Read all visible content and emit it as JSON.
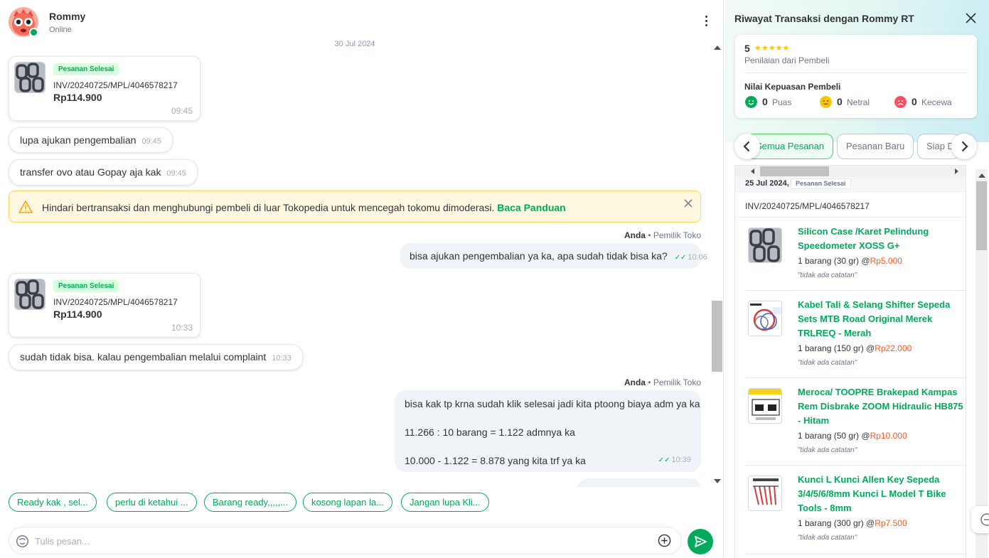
{
  "colors": {
    "accent": "#00aa5b",
    "price": "#fa591d",
    "warning_bg": "#fff8e1",
    "star": "#ffc400"
  },
  "chat": {
    "contact_name": "Rommy",
    "contact_status": "Online",
    "date_separator": "30 Jul 2024",
    "order_cards": [
      {
        "badge": "Pesanan Selesai",
        "invoice": "INV/20240725/MPL/4046578217",
        "price": "Rp114.900",
        "time": "09:45"
      },
      {
        "badge": "Pesanan Selesai",
        "invoice": "INV/20240725/MPL/4046578217",
        "price": "Rp114.900",
        "time": "10:33"
      }
    ],
    "messages": [
      {
        "text": "lupa ajukan pengembalian",
        "time": "09:45"
      },
      {
        "text": "transfer ovo atau Gopay aja kak",
        "time": "09:45"
      },
      {
        "text": "bisa ajukan pengembalian ya ka, apa sudah tidak bisa ka?",
        "time": "10:06"
      },
      {
        "text": "sudah tidak bisa. kalau pengembalian melalui complaint",
        "time": "10:33"
      },
      {
        "line1": "bisa kak tp krna sudah klik selesai jadi kita ptoong biaya adm ya ka",
        "line2": "11.266 : 10 barang = 1.122 admnya ka",
        "line3": "10.000 - 1.122 = 8.878 yang kita trf ya ka",
        "time": "10:39"
      }
    ],
    "sender": {
      "name": "Anda",
      "role": "• Pemilik Toko"
    },
    "warning": {
      "text": "Hindari bertransaksi dan menghubungi pembeli di luar Tokopedia untuk mencegah tokomu dimoderasi.",
      "link": "Baca Panduan"
    },
    "quick_replies": [
      "Ready kak , sel...",
      "perlu di ketahui ...",
      "Barang ready,,,,,...",
      "kosong lapan la...",
      "Jangan lupa Kli..."
    ],
    "input_placeholder": "Tulis pesan..."
  },
  "panel": {
    "title": "Riwayat Transaksi dengan Rommy RT",
    "rating": {
      "value": "5",
      "stars": "★★★★★",
      "label": "Penilaian dari Pembeli"
    },
    "satisfaction": {
      "title": "Nilai Kepuasan Pembeli",
      "items": [
        {
          "count": "0",
          "label": "Puas"
        },
        {
          "count": "0",
          "label": "Netral"
        },
        {
          "count": "0",
          "label": "Kecewa"
        }
      ]
    },
    "filters": [
      "Semua Pesanan",
      "Pesanan Baru",
      "Siap Dikirim"
    ],
    "order": {
      "date": "25 Jul 2024,",
      "badge": "Pesanan Selesai",
      "invoice": "INV/20240725/MPL/4046578217",
      "products": [
        {
          "name": "Silicon Case /Karet Pelindung Speedometer XOSS G+",
          "qty": "1 barang (30 gr) @",
          "price": "Rp5.000",
          "note": "\"tidak ada catatan\""
        },
        {
          "name": "Kabel Tali & Selang Shifter Sepeda Sets MTB Road Original Merek TRLREQ - Merah",
          "qty": "1 barang (150 gr) @",
          "price": "Rp22.000",
          "note": "\"tidak ada catatan\""
        },
        {
          "name": "Meroca/ TOOPRE Brakepad Kampas Rem Disbrake ZOOM Hidraulic HB875 - Hitam",
          "qty": "1 barang (50 gr) @",
          "price": "Rp10.000",
          "note": "\"tidak ada catatan\""
        },
        {
          "name": "Kunci L Kunci Allen Key Sepeda 3/4/5/6/8mm Kunci L Model T Bike Tools - 8mm",
          "qty": "1 barang (300 gr) @",
          "price": "Rp7.500",
          "note": "\"tidak ada catatan\""
        }
      ]
    }
  }
}
